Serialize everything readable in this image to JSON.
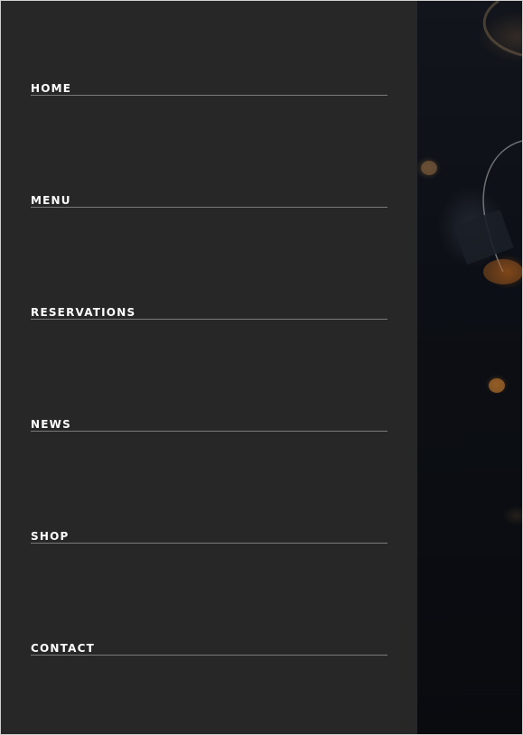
{
  "menu": {
    "items": [
      {
        "label": "HOME"
      },
      {
        "label": "MENU"
      },
      {
        "label": "RESERVATIONS"
      },
      {
        "label": "NEWS"
      },
      {
        "label": "SHOP"
      },
      {
        "label": "CONTACT"
      }
    ]
  },
  "close_icon": "close-icon",
  "colors": {
    "panel": "#272727",
    "text": "#ffffff",
    "underline": "#7a7a7a",
    "background": "#0b0c10"
  }
}
